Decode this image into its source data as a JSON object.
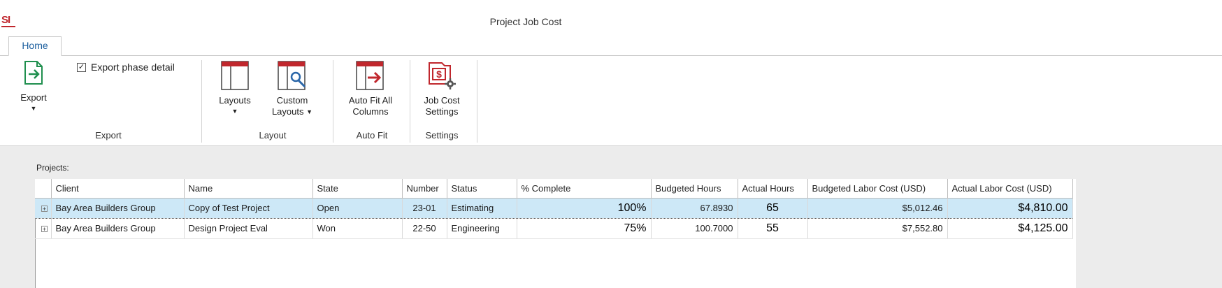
{
  "window": {
    "title": "Project Job Cost",
    "logo": "SI"
  },
  "tabs": [
    {
      "label": "Home"
    }
  ],
  "ribbon": {
    "export_group": {
      "export_label": "Export",
      "checkbox_label": "Export phase detail",
      "checkbox_checked": true,
      "group_label": "Export"
    },
    "layout_group": {
      "layouts_label": "Layouts",
      "custom_layouts_label_1": "Custom",
      "custom_layouts_label_2": "Layouts",
      "group_label": "Layout"
    },
    "autofit_group": {
      "autofit_label_1": "Auto Fit All",
      "autofit_label_2": "Columns",
      "group_label": "Auto Fit"
    },
    "settings_group": {
      "settings_label_1": "Job Cost",
      "settings_label_2": "Settings",
      "group_label": "Settings"
    }
  },
  "projects": {
    "label": "Projects:",
    "columns": [
      "Client",
      "Name",
      "State",
      "Number",
      "Status",
      "% Complete",
      "Budgeted Hours",
      "Actual Hours",
      "Budgeted Labor Cost (USD)",
      "Actual Labor Cost (USD)"
    ],
    "rows": [
      {
        "client": "Bay Area Builders Group",
        "name": "Copy of Test Project",
        "state": "Open",
        "number": "23-01",
        "status": "Estimating",
        "complete": "100%",
        "budgeted_hours": "67.8930",
        "actual_hours": "65",
        "budgeted_cost": "$5,012.46",
        "actual_cost": "$4,810.00"
      },
      {
        "client": "Bay Area Builders Group",
        "name": "Design Project Eval",
        "state": "Won",
        "number": "22-50",
        "status": "Engineering",
        "complete": "75%",
        "budgeted_hours": "100.7000",
        "actual_hours": "55",
        "budgeted_cost": "$7,552.80",
        "actual_cost": "$4,125.00"
      }
    ]
  },
  "colors": {
    "accent_red": "#c0272d",
    "accent_green": "#1f8f4e",
    "selection": "#cde8f7"
  }
}
